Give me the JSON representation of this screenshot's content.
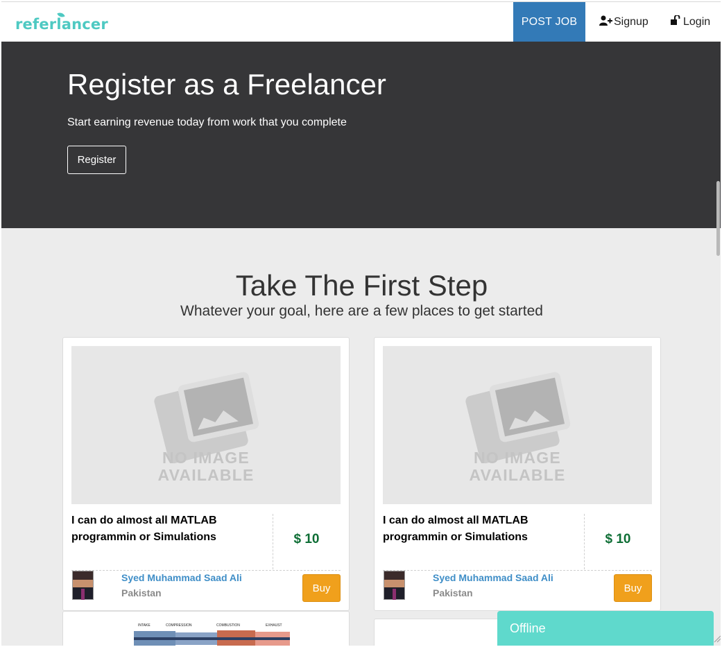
{
  "header": {
    "logo": "referlancer",
    "post_job": "POST JOB",
    "signup": "Signup",
    "login": "Login"
  },
  "hero": {
    "title": "Register as a Freelancer",
    "subtitle": "Start earning revenue today from work that you complete",
    "register_label": "Register"
  },
  "section": {
    "title": "Take The First Step",
    "subtitle": "Whatever your goal, here are a few places to get started"
  },
  "cards": [
    {
      "image_line1": "NO IMAGE",
      "image_line2": "AVAILABLE",
      "title": "I can do almost all MATLAB programmin or Simulations",
      "price": "$ 10",
      "seller_name": "Syed Muhammad Saad Ali",
      "seller_country": "Pakistan",
      "buy_label": "Buy"
    },
    {
      "image_line1": "NO IMAGE",
      "image_line2": "AVAILABLE",
      "title": "I can do almost all MATLAB programmin or Simulations",
      "price": "$ 10",
      "seller_name": "Syed Muhammad Saad Ali",
      "seller_country": "Pakistan",
      "buy_label": "Buy"
    }
  ],
  "engine_labels": [
    "INTAKE",
    "COMPRESSION",
    "COMBUSTION",
    "EXHAUST"
  ],
  "chat": {
    "status": "Offline"
  },
  "colors": {
    "brand": "#4ec9c2",
    "post_job_bg": "#337ab7",
    "hero_bg": "#363638",
    "price": "#0e6e35",
    "seller_link": "#3f8ec7",
    "buy_bg": "#f0a01c",
    "chat_bg": "#5fd9cc"
  },
  "icons": {
    "signup": "user-plus-icon",
    "login": "unlock-icon",
    "placeholder": "image-placeholder-icon"
  }
}
